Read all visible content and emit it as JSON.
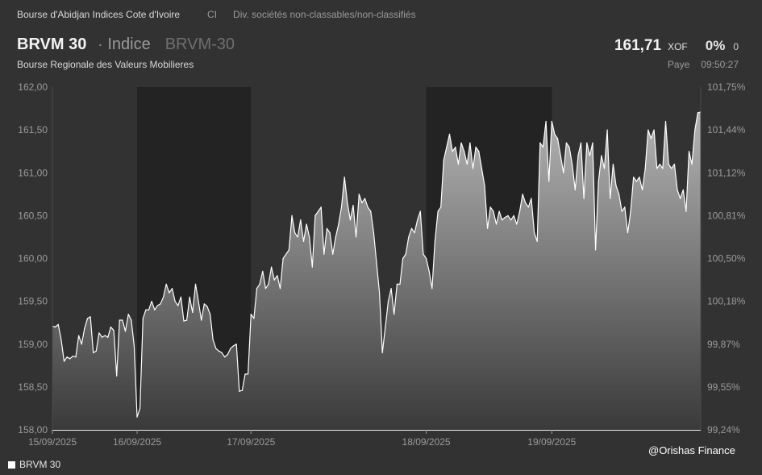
{
  "header": {
    "exchange": "Bourse d'Abidjan Indices Cote d'Ivoire",
    "country_code": "CI",
    "sector": "Div. sociétés non-classables/non-classifiés",
    "name": "BRVM 30",
    "separator": "·",
    "instrument_type": "Indice",
    "code": "BRVM-30",
    "subtitle": "Bourse Regionale des Valeurs Mobilieres"
  },
  "quote": {
    "price": "161,71",
    "currency": "XOF",
    "change_pct": "0%",
    "change_abs": "0",
    "market": "Paye",
    "time": "09:50:27"
  },
  "legend": {
    "label": "BRVM 30"
  },
  "watermark": "@Orishas Finance",
  "colors": {
    "background": "#323232",
    "shade_band": "#232323",
    "line": "#ffffff",
    "fill_top": "#b4b4b4",
    "fill_bottom": "#3a3a3a"
  },
  "chart_data": {
    "type": "area",
    "series": [
      {
        "name": "BRVM 30",
        "values": [
          159.21,
          159.2,
          159.23,
          159.05,
          158.8,
          158.85,
          158.83,
          158.86,
          158.85,
          159.1,
          159.0,
          159.18,
          159.3,
          159.32,
          158.9,
          158.92,
          159.13,
          159.08,
          159.1,
          159.08,
          159.2,
          159.16,
          158.63,
          159.28,
          159.28,
          159.15,
          159.35,
          159.28,
          158.98,
          158.15,
          158.25,
          159.3,
          159.4,
          159.4,
          159.5,
          159.4,
          159.45,
          159.47,
          159.55,
          159.7,
          159.6,
          159.65,
          159.5,
          159.45,
          159.55,
          159.27,
          159.28,
          159.55,
          159.37,
          159.7,
          159.5,
          159.28,
          159.47,
          159.44,
          159.35,
          159.05,
          158.95,
          158.92,
          158.9,
          158.85,
          158.88,
          158.95,
          158.98,
          159.0,
          158.45,
          158.46,
          158.65,
          158.65,
          159.35,
          159.3,
          159.65,
          159.7,
          159.85,
          159.65,
          159.7,
          159.9,
          159.75,
          159.8,
          159.65,
          160.0,
          160.05,
          160.1,
          160.5,
          160.3,
          160.25,
          160.45,
          160.2,
          160.4,
          160.25,
          159.9,
          160.5,
          160.55,
          160.6,
          160.05,
          160.35,
          160.3,
          160.05,
          160.25,
          160.4,
          160.6,
          160.95,
          160.65,
          160.45,
          160.62,
          160.25,
          160.75,
          160.65,
          160.7,
          160.6,
          160.55,
          160.3,
          159.95,
          159.6,
          158.9,
          159.2,
          159.5,
          159.65,
          159.35,
          159.7,
          159.7,
          160.0,
          160.05,
          160.25,
          160.35,
          160.3,
          160.45,
          160.55,
          160.05,
          160.0,
          159.85,
          159.65,
          160.2,
          160.55,
          160.6,
          161.15,
          161.3,
          161.45,
          161.25,
          161.3,
          161.1,
          161.35,
          161.25,
          161.1,
          161.35,
          161.05,
          161.3,
          161.25,
          161.05,
          160.85,
          160.35,
          160.6,
          160.55,
          160.4,
          160.55,
          160.45,
          160.48,
          160.5,
          160.45,
          160.5,
          160.4,
          160.55,
          160.75,
          160.65,
          160.6,
          160.7,
          160.3,
          160.2,
          161.35,
          161.3,
          161.6,
          160.9,
          161.6,
          161.45,
          161.4,
          161.2,
          161.0,
          161.35,
          161.3,
          161.1,
          160.8,
          161.2,
          161.35,
          160.7,
          161.35,
          161.2,
          161.35,
          160.1,
          160.9,
          161.2,
          161.05,
          161.5,
          160.7,
          161.1,
          160.85,
          160.75,
          160.55,
          160.6,
          160.3,
          160.55,
          160.95,
          160.9,
          160.95,
          160.8,
          161.05,
          161.5,
          161.4,
          161.5,
          161.05,
          161.1,
          161.05,
          161.6,
          161.1,
          161.05,
          161.1,
          160.8,
          160.7,
          160.8,
          160.55,
          161.25,
          161.1,
          161.5,
          161.7,
          161.71
        ]
      }
    ],
    "x_tick_labels": [
      "15/09/2025",
      "16/09/2025",
      "17/09/2025",
      "18/09/2025",
      "19/09/2025"
    ],
    "x_day_boundaries": [
      0,
      29,
      68,
      128,
      171,
      227
    ],
    "shaded_days": [
      "16/09/2025",
      "18/09/2025"
    ],
    "ylim": [
      158.0,
      162.0
    ],
    "y_tick_values": [
      158.0,
      158.5,
      159.0,
      159.5,
      160.0,
      160.5,
      161.0,
      161.5,
      162.0
    ],
    "y_tick_labels": [
      "158,00",
      "158,50",
      "159,00",
      "159,50",
      "160,00",
      "160,50",
      "161,00",
      "161,50",
      "162,00"
    ],
    "y2_tick_labels": [
      "99,24%",
      "99,55%",
      "99,87%",
      "100,18%",
      "100,50%",
      "100,81%",
      "101,12%",
      "101,44%",
      "101,75%"
    ],
    "grid": false,
    "legend_position": "bottom-left"
  }
}
